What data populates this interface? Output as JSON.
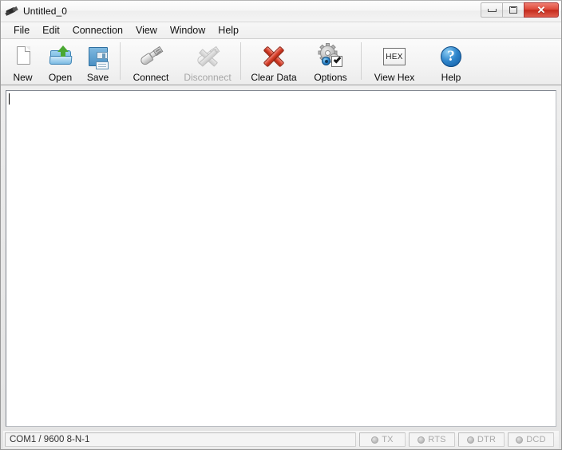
{
  "window": {
    "title": "Untitled_0",
    "app_icon": "serial-plug-icon",
    "controls": {
      "minimize": "minimize-icon",
      "maximize": "maximize-icon",
      "close": "✕"
    }
  },
  "menubar": {
    "items": [
      {
        "label": "File",
        "name": "menu-file"
      },
      {
        "label": "Edit",
        "name": "menu-edit"
      },
      {
        "label": "Connection",
        "name": "menu-connection"
      },
      {
        "label": "View",
        "name": "menu-view"
      },
      {
        "label": "Window",
        "name": "menu-window"
      },
      {
        "label": "Help",
        "name": "menu-help"
      }
    ]
  },
  "toolbar": {
    "buttons": [
      {
        "label": "New",
        "icon": "new-page-icon",
        "enabled": true
      },
      {
        "label": "Open",
        "icon": "open-folder-icon",
        "enabled": true
      },
      {
        "label": "Save",
        "icon": "save-floppy-icon",
        "enabled": true
      },
      {
        "label": "Connect",
        "icon": "usb-plug-icon",
        "enabled": true
      },
      {
        "label": "Disconnect",
        "icon": "usb-plug-disconnect-icon",
        "enabled": false
      },
      {
        "label": "Clear Data",
        "icon": "red-x-icon",
        "enabled": true
      },
      {
        "label": "Options",
        "icon": "gears-settings-icon",
        "enabled": true
      },
      {
        "label": "View Hex",
        "icon": "hex-box-icon",
        "enabled": true
      },
      {
        "label": "Help",
        "icon": "help-question-icon",
        "enabled": true
      }
    ],
    "hex_glyph": "HEX",
    "help_glyph": "?"
  },
  "terminal": {
    "content": "",
    "caret_visible": true
  },
  "statusbar": {
    "connection": "COM1 / 9600 8-N-1",
    "indicators": [
      {
        "label": "TX",
        "active": false
      },
      {
        "label": "RTS",
        "active": false
      },
      {
        "label": "DTR",
        "active": false
      },
      {
        "label": "DCD",
        "active": false
      }
    ]
  },
  "colors": {
    "close_button": "#c42b1c",
    "accent_blue": "#2f85cb",
    "clear_red": "#d9432f",
    "folder_blue": "#5fa9d8",
    "arrow_green": "#4aa832"
  }
}
